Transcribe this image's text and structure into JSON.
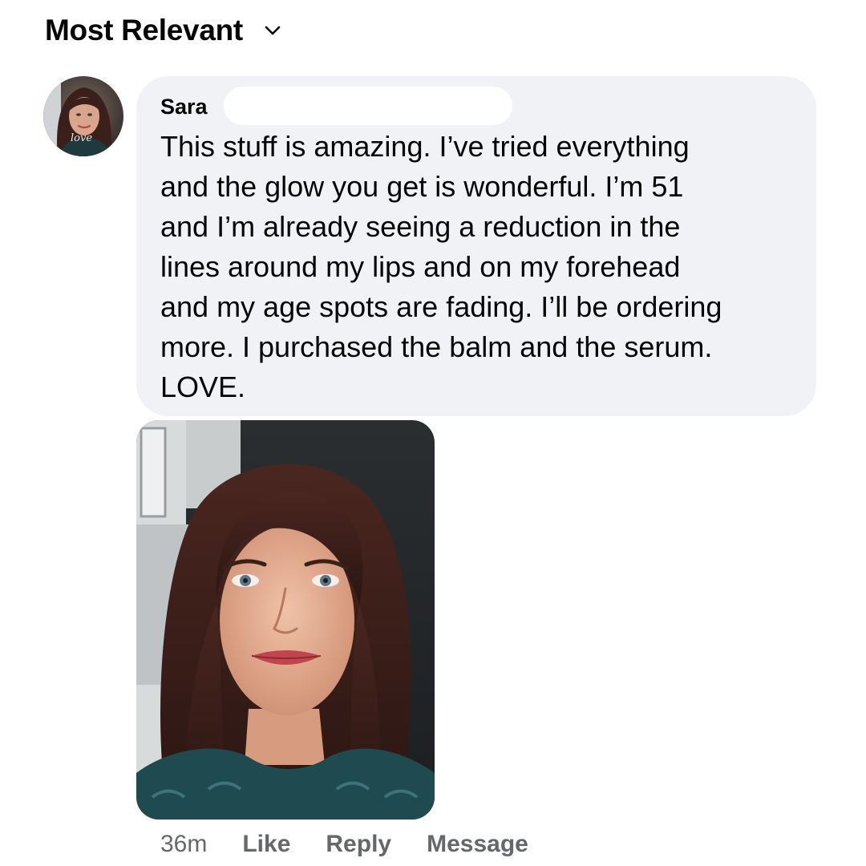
{
  "sort": {
    "label": "Most Relevant",
    "icon": "chevron-down-icon"
  },
  "comment": {
    "author": "Sara",
    "avatar_overlay_text": "love",
    "text": "This stuff is amazing. I’ve tried everything\nand the glow you get is wonderful. I’m 51\nand I’m already seeing a reduction in the\nlines around my lips and on my forehead\nand my age spots are fading. I’ll be ordering\nmore. I purchased the balm and the serum.\nLOVE.",
    "photo": "selfie-photo"
  },
  "actions": {
    "time": "36m",
    "like": "Like",
    "reply": "Reply",
    "message": "Message"
  },
  "colors": {
    "bubble": "#f0f2f5",
    "secondary_text": "#65676b",
    "primary_text": "#050505"
  }
}
